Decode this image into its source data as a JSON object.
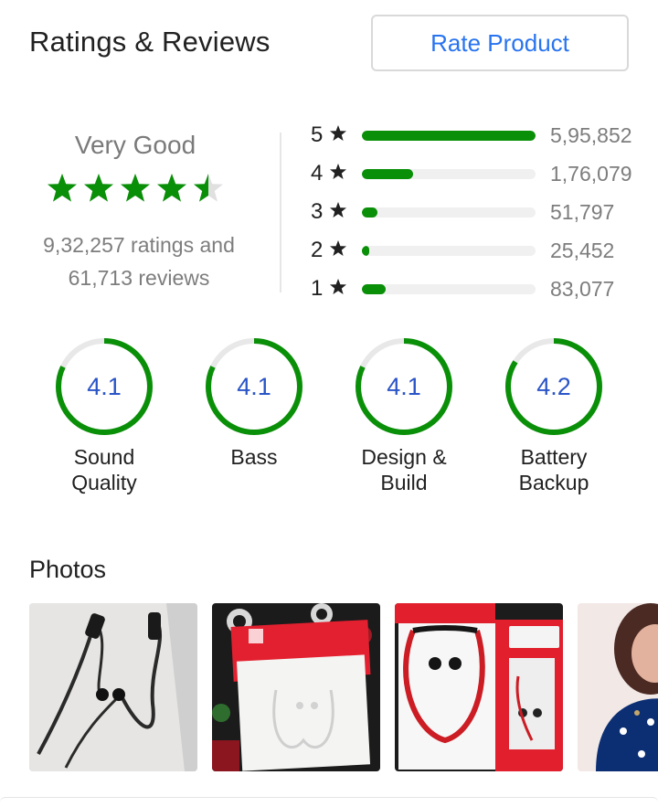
{
  "header": {
    "title": "Ratings & Reviews",
    "rate_button": "Rate Product"
  },
  "summary": {
    "verdict": "Very Good",
    "stars_value": 4.5,
    "ratings_line": "9,32,257 ratings and",
    "reviews_line": "61,713 reviews",
    "star_color": "#0a8f08"
  },
  "distribution": [
    {
      "stars": "5",
      "count": "5,95,852",
      "fraction": 1.0
    },
    {
      "stars": "4",
      "count": "1,76,079",
      "fraction": 0.296
    },
    {
      "stars": "3",
      "count": "51,797",
      "fraction": 0.087
    },
    {
      "stars": "2",
      "count": "25,452",
      "fraction": 0.043
    },
    {
      "stars": "1",
      "count": "83,077",
      "fraction": 0.139
    }
  ],
  "aspects": [
    {
      "score": "4.1",
      "line1": "Sound",
      "line2": "Quality",
      "fraction": 0.82
    },
    {
      "score": "4.1",
      "line1": "Bass",
      "line2": "",
      "fraction": 0.82
    },
    {
      "score": "4.1",
      "line1": "Design &",
      "line2": "Build",
      "fraction": 0.82
    },
    {
      "score": "4.2",
      "line1": "Battery",
      "line2": "Backup",
      "fraction": 0.84
    }
  ],
  "photos": {
    "title": "Photos"
  },
  "colors": {
    "accent_green": "#0a8f08",
    "link_blue": "#2874f0",
    "score_blue": "#2a55c7"
  }
}
